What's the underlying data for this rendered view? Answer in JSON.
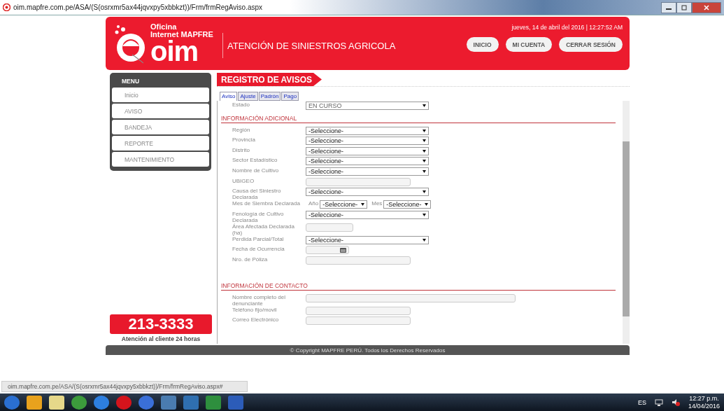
{
  "window": {
    "title": "oim.mapfre.com.pe/ASA/(S(osrxmr5ax44jqvxpy5xbbkzt))/Frm/frmRegAviso.aspx"
  },
  "header": {
    "logo_top": "Oficina",
    "logo_mid": "Internet MAPFRE",
    "logo_word": "oim",
    "title": "ATENCIÓN DE SINIESTROS AGRICOLA",
    "datetime": "jueves, 14 de abril del 2016 | 12:27:52 AM",
    "buttons": [
      "INICIO",
      "MI CUENTA",
      "CERRAR SESIÓN"
    ]
  },
  "menu": {
    "title": "MENU",
    "items": [
      {
        "label": "Inicio",
        "selected": false
      },
      {
        "label": "AVISO",
        "selected": false
      },
      {
        "label": "BANDEJA",
        "selected": false
      },
      {
        "label": "REPORTE",
        "selected": false
      },
      {
        "label": "MANTENIMIENTO",
        "selected": false
      }
    ]
  },
  "phone": {
    "number": "213-3333",
    "caption": "Atención al cliente 24 horas"
  },
  "page_title": "REGISTRO DE AVISOS",
  "tabs": [
    {
      "label": "Aviso",
      "selected": true
    },
    {
      "label": "Ajuste",
      "selected": false
    },
    {
      "label": "Padrón",
      "selected": false
    },
    {
      "label": "Pago",
      "selected": false
    }
  ],
  "estado": {
    "label": "Estado",
    "value": "EN CURSO"
  },
  "sections": [
    {
      "title": "INFORMACIÓN ADICIONAL",
      "fields": [
        {
          "kind": "select",
          "label": "Región",
          "value": "-Seleccione-"
        },
        {
          "kind": "select",
          "label": "Provincia",
          "value": "-Seleccione-"
        },
        {
          "kind": "select",
          "label": "Distrito",
          "value": "-Seleccione-"
        },
        {
          "kind": "select",
          "label": "Sector Estadístico",
          "value": "-Seleccione-"
        },
        {
          "kind": "select",
          "label": "Nombre de Cultivo",
          "value": "-Seleccione-"
        },
        {
          "kind": "text",
          "label": "UBIGEO"
        },
        {
          "kind": "select",
          "label": "Causa del Siniestro Declarada",
          "value": "-Seleccione-"
        },
        {
          "kind": "yearmonth",
          "label": "Mes de Siembra Declarada",
          "year_label": "Año",
          "year_value": "-Seleccione-",
          "month_label": "Mes",
          "month_value": "-Seleccione-"
        },
        {
          "kind": "select",
          "label": "Fenología de Cultivo Declarada",
          "value": "-Seleccione-"
        },
        {
          "kind": "short_text",
          "label": "Área Afectada Declarada (ha)"
        },
        {
          "kind": "select",
          "label": "Perdida Parcial/Total",
          "value": "-Seleccione-"
        },
        {
          "kind": "date",
          "label": "Fecha de Ocurrencia"
        },
        {
          "kind": "text",
          "label": "Nro. de Póliza"
        }
      ]
    },
    {
      "title": "INFORMACIÓN DE CONTACTO",
      "fields": [
        {
          "kind": "long_text",
          "label": "Nombre completo del denunciante"
        },
        {
          "kind": "text",
          "label": "Teléfono fijo/movil"
        },
        {
          "kind": "text",
          "label": "Correo Electrónico"
        }
      ]
    }
  ],
  "footer": "© Copyright MAPFRE PERÚ. Todos los Derechos Reservados",
  "status_url": "oim.mapfre.com.pe/ASA/(S(osrxmr5ax44jqvxpy5xbbkzt))/Frm/frmRegAviso.aspx#",
  "tray": {
    "language": "ES",
    "time": "12:27 p.m.",
    "date": "14/04/2016"
  }
}
